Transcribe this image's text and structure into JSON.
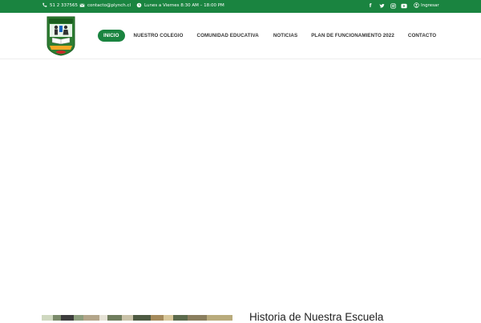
{
  "topbar": {
    "phone": "51 2 337565",
    "email": "contacto@plynch.cl",
    "hours": "Lunes a Viernes 8:30 AM – 18:00 PM",
    "login": "Ingresar",
    "social_icons": [
      "facebook-icon",
      "twitter-icon",
      "instagram-icon",
      "youtube-icon"
    ],
    "bg_color": "#1a8440"
  },
  "nav": {
    "items": [
      "INICIO",
      "NUESTRO COLEGIO",
      "COMUNIDAD EDUCATIVA",
      "NOTICIAS",
      "PLAN DE FUNCIONAMIENTO 2022",
      "CONTACTO"
    ],
    "active": "INICIO",
    "accent": "#1a8440"
  },
  "section": {
    "title": "Historia de Nuestra Escuela"
  }
}
